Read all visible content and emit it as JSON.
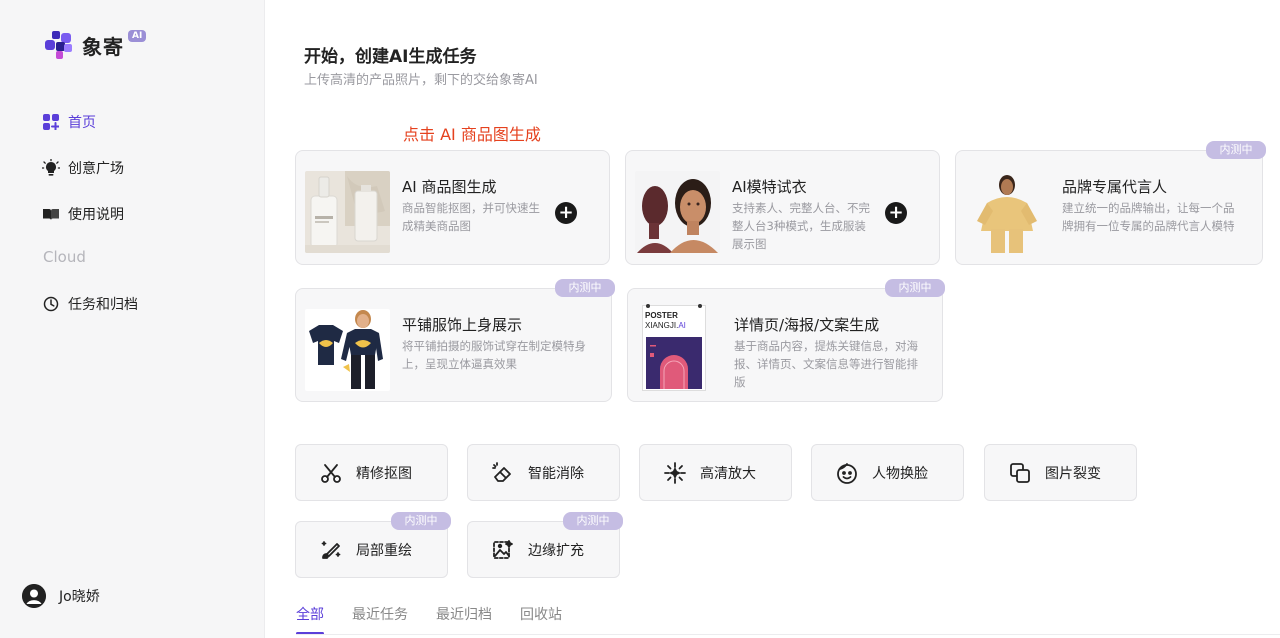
{
  "brand": {
    "name": "象寄",
    "badge": "AI"
  },
  "sidebar": {
    "items": [
      {
        "label": "首页",
        "icon": "grid-plus-icon",
        "active": true
      },
      {
        "label": "创意广场",
        "icon": "lightbulb-icon"
      },
      {
        "label": "使用说明",
        "icon": "book-icon"
      }
    ],
    "section_label": "Cloud",
    "cloud_items": [
      {
        "label": "任务和归档",
        "icon": "clock-icon"
      }
    ],
    "user_name": "Jo晓娇"
  },
  "main": {
    "title": "开始，创建AI生成任务",
    "subtitle": "上传高清的产品照片，剩下的交给象寄AI",
    "annotation": "点击 AI 商品图生成"
  },
  "cards": [
    {
      "title": "AI 商品图生成",
      "desc": "商品智能抠图，并可快速生成精美商品图"
    },
    {
      "title": "AI模特试衣",
      "desc": "支持素人、完整人台、不完整人台3种模式，生成服装展示图"
    },
    {
      "title": "品牌专属代言人",
      "desc": "建立统一的品牌输出，让每一个品牌拥有一位专属的品牌代言人模特",
      "badge": "内测中"
    },
    {
      "title": "平铺服饰上身展示",
      "desc": "将平铺拍摄的服饰试穿在制定模特身上，呈现立体逼真效果",
      "badge": "内测中"
    },
    {
      "title": "详情页/海报/文案生成",
      "desc": "基于商品内容，提炼关键信息，对海报、详情页、文案信息等进行智能排版",
      "badge": "内测中",
      "poster_title": "POSTER",
      "poster_sub_a": "XIANGJI.",
      "poster_sub_b": "AI"
    }
  ],
  "tools": [
    {
      "label": "精修抠图",
      "icon": "scissors-icon"
    },
    {
      "label": "智能消除",
      "icon": "eraser-icon"
    },
    {
      "label": "高清放大",
      "icon": "sparkle-icon"
    },
    {
      "label": "人物换脸",
      "icon": "face-icon"
    },
    {
      "label": "图片裂变",
      "icon": "copy-squares-icon"
    },
    {
      "label": "局部重绘",
      "icon": "magic-brush-icon",
      "badge": "内测中"
    },
    {
      "label": "边缘扩充",
      "icon": "image-expand-icon",
      "badge": "内测中"
    }
  ],
  "tabs": [
    {
      "label": "全部",
      "active": true
    },
    {
      "label": "最近任务"
    },
    {
      "label": "最近归档"
    },
    {
      "label": "回收站"
    }
  ],
  "colors": {
    "accent": "#5b3fd9",
    "annotation": "#e5411e",
    "badge": "#c5bde3"
  }
}
